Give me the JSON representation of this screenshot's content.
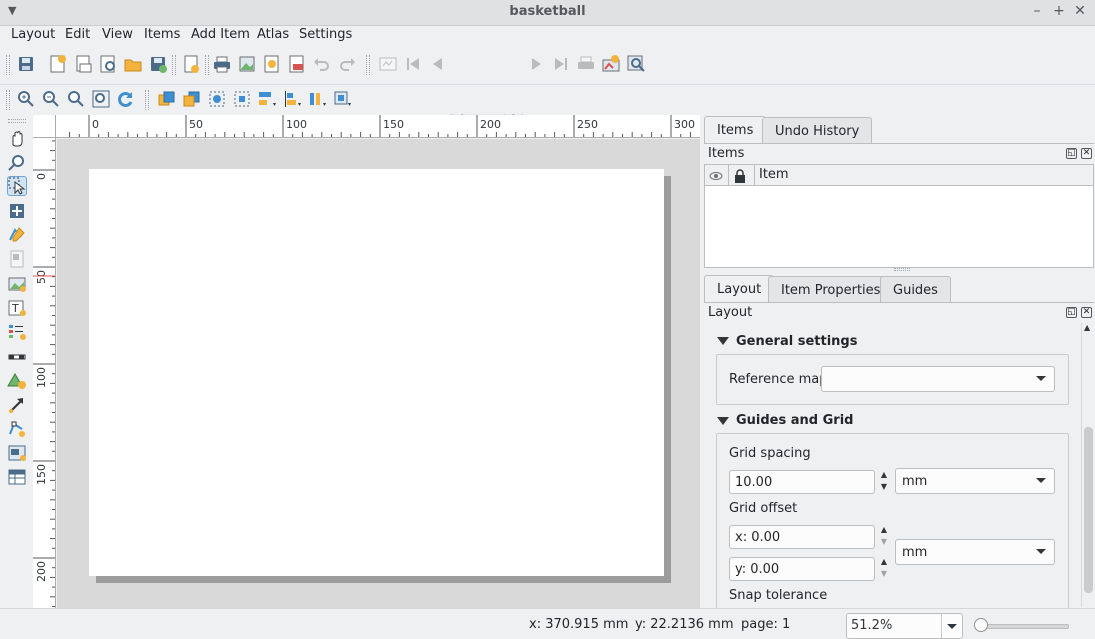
{
  "window": {
    "title": "basketball"
  },
  "menubar": [
    "Layout",
    "Edit",
    "View",
    "Items",
    "Add Item",
    "Atlas",
    "Settings"
  ],
  "toolbar": {
    "page_value": "1"
  },
  "ruler": {
    "h_labels": [
      "0",
      "50",
      "100",
      "150",
      "200",
      "250",
      "300"
    ],
    "v_labels": [
      "0",
      "50",
      "100",
      "150",
      "200"
    ]
  },
  "items_panel": {
    "tabs": [
      "Items",
      "Undo History"
    ],
    "title": "Items",
    "column_item": "Item"
  },
  "layout_panel": {
    "tabs": [
      "Layout",
      "Item Properties",
      "Guides"
    ],
    "title": "Layout",
    "general_settings": {
      "heading": "General settings",
      "reference_map_label": "Reference map",
      "reference_map_value": ""
    },
    "guides_grid": {
      "heading": "Guides and Grid",
      "grid_spacing_label": "Grid spacing",
      "grid_spacing_value": "10.00",
      "grid_spacing_unit": "mm",
      "grid_offset_label": "Grid offset",
      "offset_x": "x: 0.00",
      "offset_y": "y: 0.00",
      "offset_unit": "mm",
      "snap_tolerance_label": "Snap tolerance"
    }
  },
  "status": {
    "x": "x: 370.915 mm",
    "y": "y: 22.2136 mm",
    "page": "page: 1",
    "zoom": "51.2%"
  },
  "icons": {
    "toolbar1": [
      "save-icon",
      "new-layout-icon",
      "duplicate-layout-icon",
      "layout-manager-icon",
      "open-template-icon",
      "save-template-icon",
      "add-page-icon",
      "print-icon",
      "export-image-icon",
      "export-svg-icon",
      "export-pdf-icon",
      "undo-icon",
      "redo-icon",
      "atlas-preview-icon",
      "first-feature-icon",
      "previous-feature-icon",
      "next-feature-icon",
      "last-feature-icon",
      "atlas-print-icon",
      "atlas-export-icon",
      "atlas-settings-icon"
    ],
    "toolbar2": [
      "zoom-in-icon",
      "zoom-out-icon",
      "zoom-actual-icon",
      "zoom-full-icon",
      "refresh-icon",
      "raise-items-icon",
      "lower-items-icon",
      "group-icon",
      "ungroup-icon",
      "align-icon",
      "distribute-icon",
      "resize-icon",
      "lock-icon"
    ],
    "left": [
      "pan-icon",
      "zoom-tool-icon",
      "select-icon",
      "move-content-icon",
      "edit-nodes-icon",
      "add-map-icon",
      "add-picture-icon",
      "add-label-icon",
      "add-legend-icon",
      "add-scalebar-icon",
      "add-shape-icon",
      "add-arrow-icon",
      "add-nodes-icon",
      "add-html-icon",
      "add-table-icon"
    ]
  }
}
